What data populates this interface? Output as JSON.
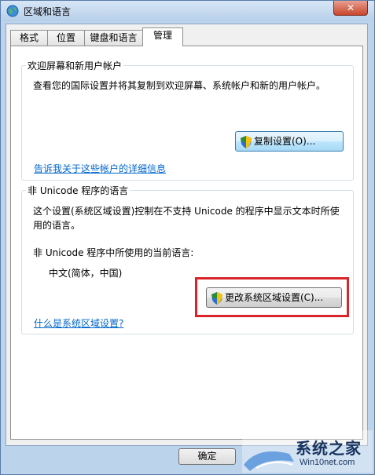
{
  "window": {
    "title": "区域和语言",
    "close_label": "✕"
  },
  "tabs": [
    {
      "label": "格式",
      "active": false
    },
    {
      "label": "位置",
      "active": false
    },
    {
      "label": "键盘和语言",
      "active": false
    },
    {
      "label": "管理",
      "active": true
    }
  ],
  "welcome_group": {
    "title": "欢迎屏幕和新用户帐户",
    "description": "查看您的国际设置并将其复制到欢迎屏幕、系统帐户和新的用户帐户。",
    "copy_button": "复制设置(O)...",
    "link": "告诉我关于这些帐户的详细信息"
  },
  "unicode_group": {
    "title": "非 Unicode 程序的语言",
    "description_line1": "这个设置(系统区域设置)控制在不支持 Unicode 的程序中显示文本时所使",
    "description_line2": "用的语言。",
    "current_label": "非 Unicode 程序中所使用的当前语言:",
    "current_value": "中文(简体，中国)",
    "change_button": "更改系统区域设置(C)...",
    "link": "什么是系统区域设置?"
  },
  "footer": {
    "ok_button": "确定"
  },
  "watermark": {
    "brand": "系统之家",
    "url": "Win10net.com"
  }
}
